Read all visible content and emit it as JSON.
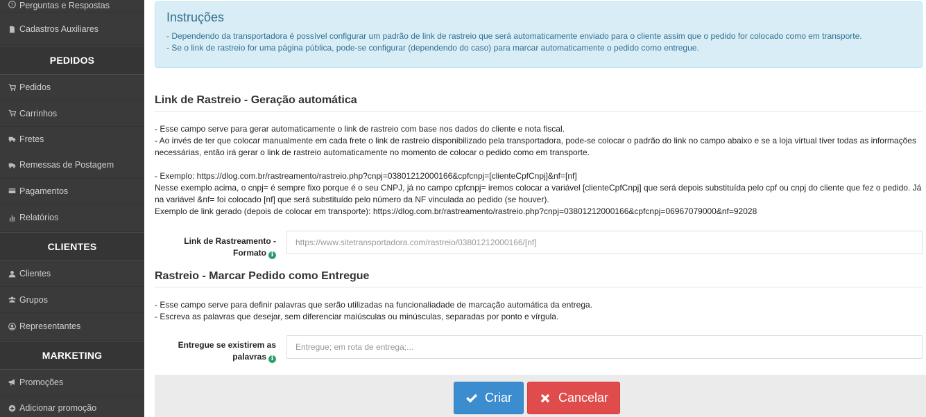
{
  "sidebar": {
    "top_items": [
      {
        "label": "Perguntas e Respostas",
        "icon": "question-circle-icon"
      },
      {
        "label": "Cadastros Auxiliares",
        "icon": "file-icon"
      }
    ],
    "sections": [
      {
        "heading": "PEDIDOS",
        "items": [
          {
            "label": "Pedidos",
            "icon": "cart-icon"
          },
          {
            "label": "Carrinhos",
            "icon": "cart-icon"
          },
          {
            "label": "Fretes",
            "icon": "truck-icon"
          },
          {
            "label": "Remessas de Postagem",
            "icon": "truck-icon"
          },
          {
            "label": "Pagamentos",
            "icon": "credit-card-icon"
          },
          {
            "label": "Relatórios",
            "icon": "bar-chart-icon"
          }
        ]
      },
      {
        "heading": "CLIENTES",
        "items": [
          {
            "label": "Clientes",
            "icon": "user-icon"
          },
          {
            "label": "Grupos",
            "icon": "users-icon"
          },
          {
            "label": "Representantes",
            "icon": "user-circle-icon"
          }
        ]
      },
      {
        "heading": "MARKETING",
        "items": [
          {
            "label": "Promoções",
            "icon": "bullhorn-icon"
          },
          {
            "label": "Adicionar promoção",
            "icon": "plus-circle-icon"
          }
        ]
      }
    ]
  },
  "alert": {
    "title": "Instruções",
    "lines": [
      "- Dependendo da transportadora é possível configurar um padrão de link de rastreio que será automaticamente enviado para o cliente assim que o pedido for colocado como em transporte.",
      "- Se o link de rastreio for uma página pública, pode-se configurar (dependendo do caso) para marcar automaticamente o pedido como entregue."
    ]
  },
  "section1": {
    "title": "Link de Rastreio - Geração automática",
    "lines": [
      "- Esse campo serve para gerar automaticamente o link de rastreio com base nos dados do cliente e nota fiscal.",
      "- Ao invés de ter que colocar manualmente em cada frete o link de rastreio disponibilizado pela transportadora, pode-se colocar o padrão do link no campo abaixo e se a loja virtual tiver todas as informações necessárias, então irá gerar o link de rastreio automaticamente no momento de colocar o pedido como em transporte.",
      "",
      "- Exemplo: https://dlog.com.br/rastreamento/rastreio.php?cnpj=03801212000166&cpfcnpj=[clienteCpfCnpj]&nf=[nf]",
      "Nesse exemplo acima, o cnpj= é sempre fixo porque é o seu CNPJ, já no campo cpfcnpj= iremos colocar a variável [clienteCpfCnpj] que será depois substituída pelo cpf ou cnpj do cliente que fez o pedido. Já na variável &nf= foi colocado [nf] que será substituído pelo número da NF vinculada ao pedido (se houver).",
      "Exemplo de link gerado (depois de colocar em transporte): https://dlog.com.br/rastreamento/rastreio.php?cnpj=03801212000166&cpfcnpj=06967079000&nf=92028"
    ],
    "field_label": "Link de Rastreamento - Formato",
    "field_placeholder": "https://www.sitetransportadora.com/rastreio/03801212000166/[nf]",
    "field_value": ""
  },
  "section2": {
    "title": "Rastreio - Marcar Pedido como Entregue",
    "lines": [
      "- Esse campo serve para definir palavras que serão utilizadas na funcionaliadade de marcação automática da entrega.",
      "- Escreva as palavras que desejar, sem diferenciar maiúsculas ou minúsculas, separadas por ponto e vírgula."
    ],
    "field_label": "Entregue se existirem as palavras",
    "field_placeholder": "Entregue; em rota de entrega;...",
    "field_value": ""
  },
  "actions": {
    "create_label": "Criar",
    "cancel_label": "Cancelar"
  },
  "colors": {
    "sidebar_bg": "#3a3a3a",
    "primary": "#3c8dcf",
    "danger": "#e04b4b",
    "alert_bg": "#d9edf7",
    "info_icon": "#2e9e6a"
  }
}
